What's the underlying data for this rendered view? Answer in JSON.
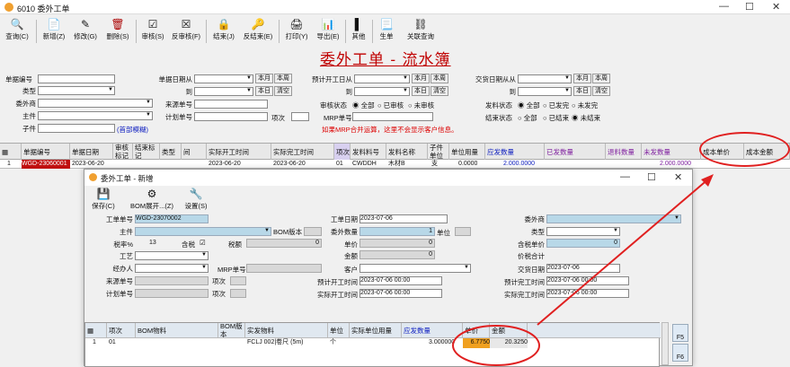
{
  "window": {
    "title": "6010 委外工单",
    "min": "—",
    "max": "☐",
    "close": "✕"
  },
  "toolbar": {
    "items": [
      "查询(C)",
      "新增(Z)",
      "修改(G)",
      "删除(S)",
      "审核(S)",
      "反审核(F)",
      "结束(J)",
      "反结束(E)",
      "打印(Y)",
      "导出(E)",
      "其他",
      "生单",
      "关联查询"
    ]
  },
  "main_title": "委外工单 - 流水簿",
  "form": {
    "doc_no": "单据编号",
    "type": "类型",
    "vendor": "委外商",
    "main_item": "主件",
    "sub_item": "子件",
    "doc_date_from": "单据日期从",
    "to": "到",
    "source_no": "来源单号",
    "plan_no": "计划单号",
    "item_no": "项次",
    "btn_month": "本月",
    "btn_week": "本周",
    "btn_today": "本日",
    "btn_clear": "清空",
    "plan_start_from": "预计开工日从",
    "audit_status": "审核状态",
    "audit_opts": [
      "全部",
      "已审核",
      "未审核"
    ],
    "mrp_no": "MRP单号",
    "note": "如果MRP合并运算，这里不会显示客户信息。",
    "delivery_from": "交货日期从从",
    "issue_status": "发料状态",
    "issue_opts": [
      "全部",
      "已发完",
      "未发完"
    ],
    "end_status": "结束状态",
    "end_opts": [
      "全部",
      "已结束",
      "未结束"
    ],
    "fuzzy": "(首部模糊)"
  },
  "grid1": {
    "headers": [
      "单据编号",
      "单据日期",
      "审核标记",
      "结束标记",
      "类型",
      "间",
      "实际开工时间",
      "实际完工时间",
      "项次",
      "发料料号",
      "发料名称",
      "子件单位",
      "单位用量",
      "应发数量",
      "已发数量",
      "退料数量",
      "未发数量",
      "成本单价",
      "成本金额"
    ],
    "row": {
      "idx": "1",
      "doc_no": "WGD-23060001",
      "date": "2023-06-20",
      "start": "2023-06-20",
      "finish": "2023-06-20",
      "item": "01",
      "part": "CWDDH",
      "name": "木材B",
      "unit": "支",
      "usage": "0.0000",
      "due": "2.000.0000",
      "unissued": "2.000.0000"
    }
  },
  "dialog": {
    "title": "委外工单 - 新增",
    "tb": [
      "保存(C)",
      "BOM展开...(Z)",
      "设置(S)"
    ],
    "labels": {
      "order_no": "工单单号",
      "main": "主件",
      "tax_rate": "税率%",
      "incl_tax": "含税",
      "tax": "税额",
      "process": "工艺",
      "handler": "经办人",
      "source_no": "来源单号",
      "item": "项次",
      "plan_no": "计划单号",
      "bom_ver": "BOM版本",
      "mrp_no": "MRP单号",
      "order_date": "工单日期",
      "qty": "委外数量",
      "unit": "单位",
      "price": "单价",
      "amount": "金额",
      "customer": "客户",
      "plan_start": "预计开工时间",
      "actual_start": "实际开工时间",
      "vendor": "委外商",
      "type": "类型",
      "price_incl": "含税单价",
      "total_incl": "价税合计",
      "delivery": "交货日期",
      "plan_finish": "预计完工时间",
      "actual_finish": "实际完工时间"
    },
    "values": {
      "order_no": "WGD-23070002",
      "tax_rate": "13",
      "tax": "0",
      "qty": "1",
      "price": "0",
      "amount": "0",
      "order_date": "2023-07-06",
      "price_incl": "0",
      "delivery": "2023-07-06",
      "plan_start": "2023-07-06 00:00",
      "actual_start": "2023-07-06 00:00",
      "plan_finish": "2023-07-06 00:00",
      "actual_finish": "2023-07-06 00:00"
    },
    "grid_headers": [
      "项次",
      "BOM物料",
      "BOM版本",
      "实发物料",
      "单位",
      "实际单位用量",
      "应发数量",
      "单价",
      "金额"
    ],
    "grid_row": {
      "idx": "1",
      "item": "01",
      "material": "FCLJ 002|卷尺 (5m)",
      "unit": "个",
      "due": "3.000000",
      "price": "6.7750",
      "amount": "20.3250"
    },
    "side": [
      "F5",
      "F6"
    ]
  },
  "colors": {
    "accent_red": "#e02020",
    "title_red": "#c00000",
    "highlight_orange": "#f0a020"
  }
}
